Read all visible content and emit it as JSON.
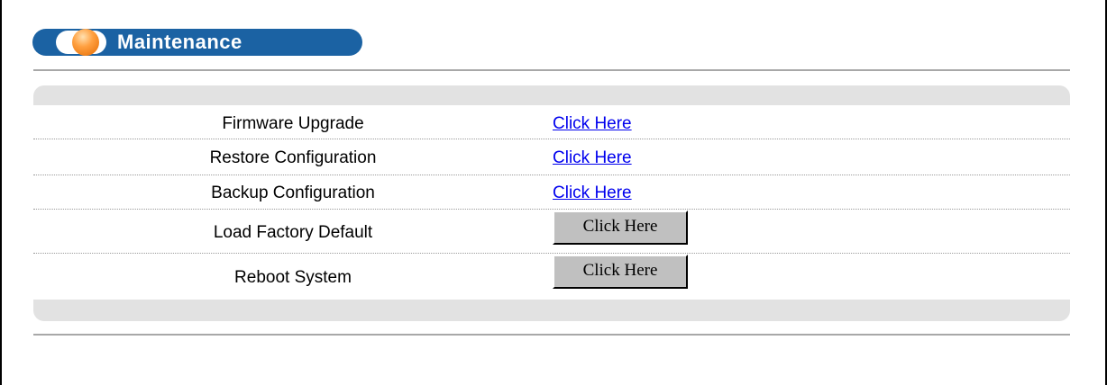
{
  "header": {
    "title": "Maintenance"
  },
  "items": [
    {
      "label": "Firmware Upgrade",
      "action": "Click Here",
      "type": "link"
    },
    {
      "label": "Restore Configuration",
      "action": "Click Here",
      "type": "link"
    },
    {
      "label": "Backup Configuration",
      "action": "Click Here",
      "type": "link"
    },
    {
      "label": "Load Factory Default",
      "action": "Click Here",
      "type": "button"
    },
    {
      "label": "Reboot System",
      "action": "Click Here",
      "type": "button"
    }
  ],
  "colors": {
    "pill": "#1b62a3",
    "link": "#0000ee",
    "panel": "#e2e2e2",
    "button": "#c0c0c0"
  }
}
